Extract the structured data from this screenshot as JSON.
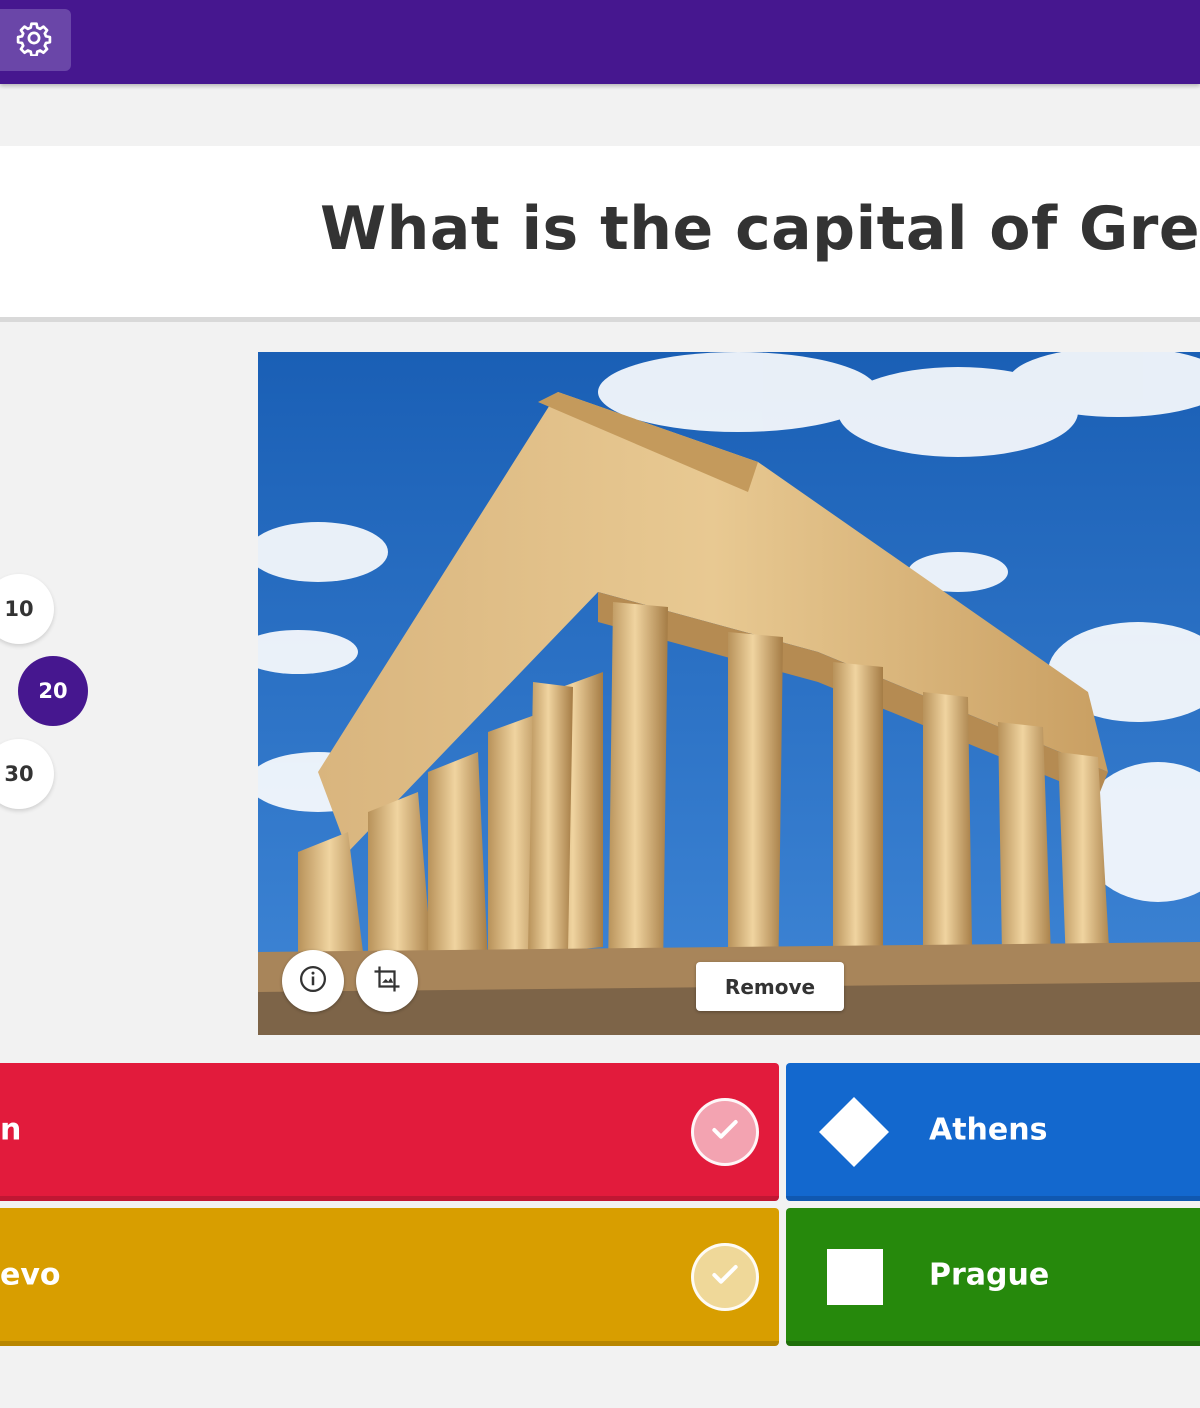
{
  "topbar": {
    "settings_icon": "gear-icon",
    "color": "#46178f"
  },
  "question": {
    "text": "What is the capital of Greece?"
  },
  "time_limit": {
    "options": [
      "10",
      "20",
      "30"
    ],
    "selected": "20",
    "selected_color": "#46178f"
  },
  "media": {
    "description_icon": "info-icon",
    "edit_icon": "crop-image-icon",
    "remove_label": "Remove"
  },
  "answers": [
    {
      "text": "Berlin",
      "visible_text": "n",
      "color": "#e21b3c",
      "shape": "triangle",
      "correct": false
    },
    {
      "text": "Athens",
      "visible_text": "Athens",
      "color": "#1368ce",
      "shape": "diamond",
      "correct": true
    },
    {
      "text": "Sarajevo",
      "visible_text": "evo",
      "color": "#d89e00",
      "shape": "circle",
      "correct": false
    },
    {
      "text": "Prague",
      "visible_text": "Prague",
      "color": "#26890c",
      "shape": "square",
      "correct": false
    }
  ]
}
